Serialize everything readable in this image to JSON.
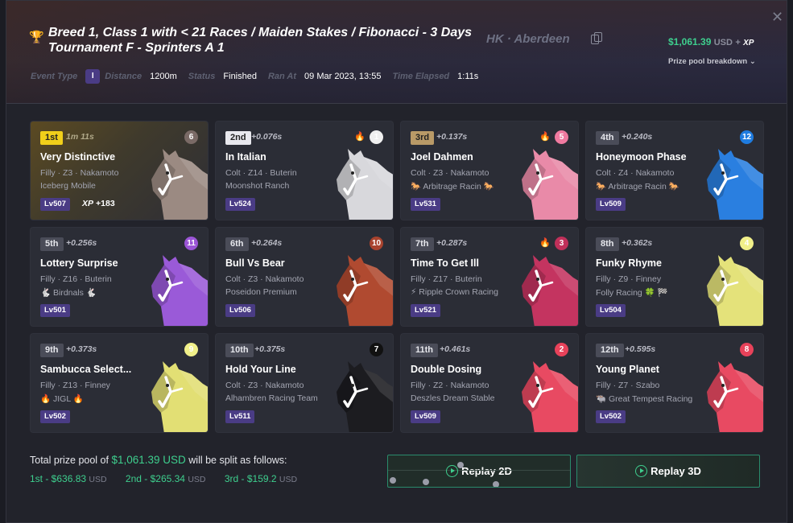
{
  "header": {
    "title": "Breed 1, Class 1 with < 21 Races / Maiden Stakes / Fibonacci - 3 Days Tournament F - Sprinters A 1",
    "location": "HK · Aberdeen",
    "prize_amount": "$1,061.39",
    "prize_currency": "USD",
    "prize_plus": "+",
    "prize_xp": "XP",
    "breakdown_label": "Prize pool breakdown",
    "close": "✕",
    "meta": {
      "event_type_label": "Event Type",
      "event_type_value": "I",
      "distance_label": "Distance",
      "distance_value": "1200m",
      "status_label": "Status",
      "status_value": "Finished",
      "ran_at_label": "Ran At",
      "ran_at_value": "09 Mar 2023, 13:55",
      "elapsed_label": "Time Elapsed",
      "elapsed_value": "1:11s"
    }
  },
  "results": [
    {
      "pos": "1st",
      "gap": "1m 11s",
      "num": "6",
      "num_bg": "#7a6a66",
      "num_fg": "#ffffff",
      "fire": false,
      "name": "Very Distinctive",
      "info": "Filly · Z3 · Nakamoto",
      "stable": "Iceberg Mobile",
      "lv": "Lv507",
      "xp_label": "XP",
      "xp_value": "+183",
      "horse": "#9b8a82"
    },
    {
      "pos": "2nd",
      "gap": "+0.076s",
      "num": "1",
      "num_bg": "#f0f0f0",
      "num_fg": "#ffffff",
      "fire": true,
      "name": "In Italian",
      "info": "Colt · Z14 · Buterin",
      "stable": "Moonshot Ranch",
      "lv": "Lv524",
      "horse": "#d8d8dc"
    },
    {
      "pos": "3rd",
      "gap": "+0.137s",
      "num": "5",
      "num_bg": "#f07aa0",
      "num_fg": "#ffffff",
      "fire": true,
      "name": "Joel Dahmen",
      "info": "Colt · Z3 · Nakamoto",
      "stable": "🐎 Arbitrage Racin 🐎",
      "lv": "Lv531",
      "horse": "#e98aa8"
    },
    {
      "pos": "4th",
      "gap": "+0.240s",
      "num": "12",
      "num_bg": "#1f7ce0",
      "num_fg": "#ffffff",
      "fire": false,
      "name": "Honeymoon Phase",
      "info": "Colt · Z4 · Nakamoto",
      "stable": "🐎 Arbitrage Racin 🐎",
      "lv": "Lv509",
      "horse": "#2a7fe0"
    },
    {
      "pos": "5th",
      "gap": "+0.256s",
      "num": "11",
      "num_bg": "#9b55d6",
      "num_fg": "#ffffff",
      "fire": false,
      "name": "Lottery Surprise",
      "info": "Filly · Z16 · Buterin",
      "stable": "🐇 Birdnals 🐇",
      "lv": "Lv501",
      "horse": "#9a5ad8"
    },
    {
      "pos": "6th",
      "gap": "+0.264s",
      "num": "10",
      "num_bg": "#a8432e",
      "num_fg": "#ffffff",
      "fire": false,
      "name": "Bull Vs Bear",
      "info": "Colt · Z3 · Nakamoto",
      "stable": "Poseidon Premium",
      "lv": "Lv506",
      "horse": "#b04a30"
    },
    {
      "pos": "7th",
      "gap": "+0.287s",
      "num": "3",
      "num_bg": "#c0305a",
      "num_fg": "#ffffff",
      "fire": true,
      "name": "Time To Get Ill",
      "info": "Filly · Z17 · Buterin",
      "stable": "⚡ Ripple Crown Racing",
      "lv": "Lv521",
      "horse": "#c43460"
    },
    {
      "pos": "8th",
      "gap": "+0.362s",
      "num": "4",
      "num_bg": "#f1f08a",
      "num_fg": "#ffffff",
      "fire": false,
      "name": "Funky Rhyme",
      "info": "Filly · Z9 · Finney",
      "stable": "Folly Racing 🍀 🏁",
      "lv": "Lv504",
      "horse": "#e4e27a"
    },
    {
      "pos": "9th",
      "gap": "+0.373s",
      "num": "9",
      "num_bg": "#f1f08a",
      "num_fg": "#ffffff",
      "fire": false,
      "name": "Sambucca Select...",
      "info": "Filly · Z13 · Finney",
      "stable": "🔥 JIGL 🔥",
      "lv": "Lv502",
      "horse": "#e2df74"
    },
    {
      "pos": "10th",
      "gap": "+0.375s",
      "num": "7",
      "num_bg": "#111111",
      "num_fg": "#ffffff",
      "fire": false,
      "name": "Hold Your Line",
      "info": "Colt · Z3 · Nakamoto",
      "stable": "Alhambren Racing Team",
      "lv": "Lv511",
      "horse": "#1c1c20"
    },
    {
      "pos": "11th",
      "gap": "+0.461s",
      "num": "2",
      "num_bg": "#e8425a",
      "num_fg": "#ffffff",
      "fire": false,
      "name": "Double Dosing",
      "info": "Filly · Z2 · Nakamoto",
      "stable": "Deszles Dream Stable",
      "lv": "Lv509",
      "horse": "#e84a62"
    },
    {
      "pos": "12th",
      "gap": "+0.595s",
      "num": "8",
      "num_bg": "#e8425a",
      "num_fg": "#ffffff",
      "fire": false,
      "name": "Young Planet",
      "info": "Filly · Z7 · Szabo",
      "stable": "🐃 Great Tempest Racing",
      "lv": "Lv502",
      "horse": "#e84a62"
    }
  ],
  "footer": {
    "text_prefix": "Total prize pool of",
    "total": "$1,061.39 USD",
    "text_suffix": "will be split as follows:",
    "prizes": [
      {
        "label": "1st - $636.83",
        "currency": "USD"
      },
      {
        "label": "2nd - $265.34",
        "currency": "USD"
      },
      {
        "label": "3rd - $159.2",
        "currency": "USD"
      }
    ],
    "replay_2d": "Replay 2D",
    "replay_3d": "Replay 3D"
  },
  "colors": {
    "accent_green": "#3ecf8e",
    "level_purple": "#4a3c85",
    "gold": "#f1cf1a"
  }
}
